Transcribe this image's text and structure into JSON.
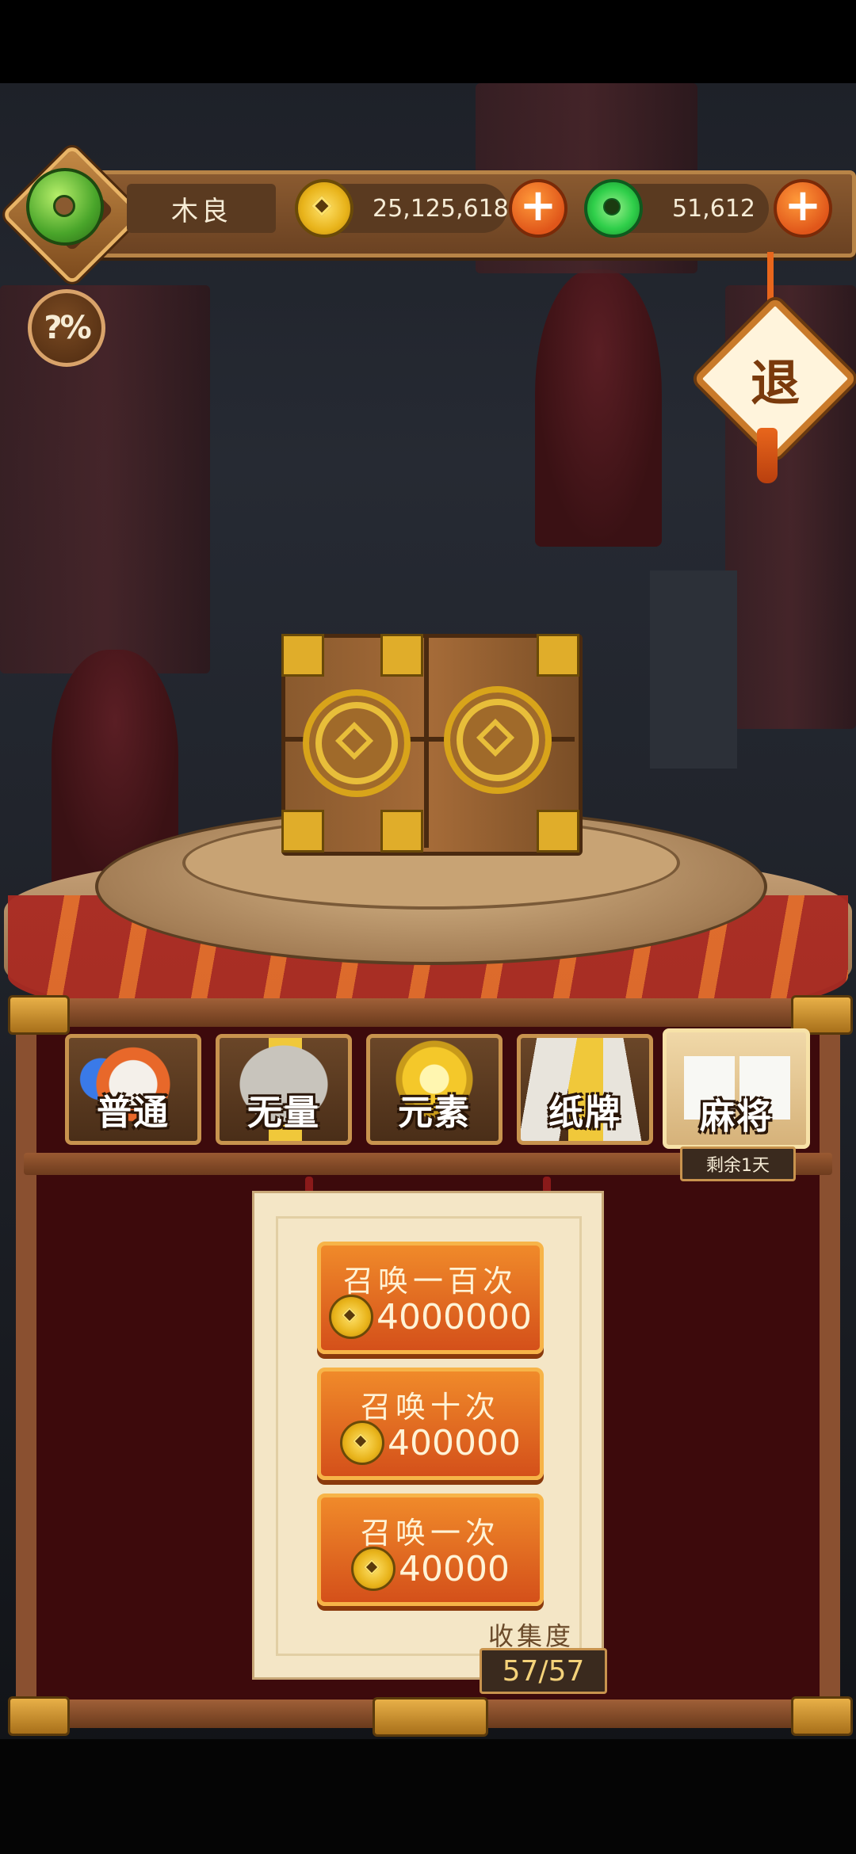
{
  "player": {
    "name": "木良"
  },
  "currency": {
    "coins": "25,125,618",
    "jade": "51,612",
    "add_symbol": "+"
  },
  "buttons": {
    "odds": "?%",
    "exit": "退"
  },
  "tabs": [
    {
      "label": "普通",
      "active": false
    },
    {
      "label": "无量",
      "active": false
    },
    {
      "label": "元素",
      "active": false
    },
    {
      "label": "纸牌",
      "active": false
    },
    {
      "label": "麻将",
      "active": true
    }
  ],
  "tab_badge": "剩余1天",
  "summon_options": [
    {
      "title": "召唤一百次",
      "cost": "4000000"
    },
    {
      "title": "召唤十次",
      "cost": "400000"
    },
    {
      "title": "召唤一次",
      "cost": "40000"
    }
  ],
  "collection": {
    "label": "收集度",
    "value": "57/57"
  },
  "colors": {
    "accent_orange": "#e0561a",
    "coin_gold": "#e8b31a",
    "jade_green": "#2fcf4a",
    "panel_red": "#3d0a0c"
  }
}
